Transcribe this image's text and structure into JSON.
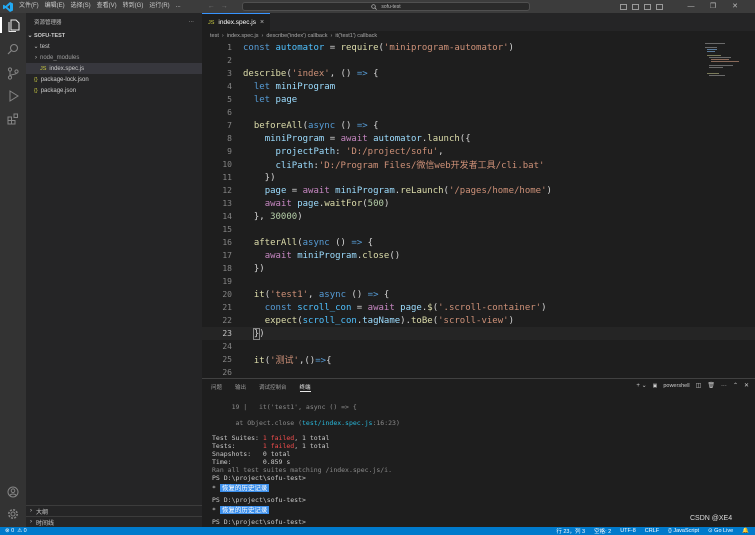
{
  "titlebar": {
    "menu": [
      "文件(F)",
      "编辑(E)",
      "选择(S)",
      "查看(V)",
      "转到(G)",
      "运行(R)",
      "..."
    ],
    "search_text": "sofu-test",
    "nav_back": "←",
    "nav_forward": "→"
  },
  "sidebar": {
    "header": "资源管理器",
    "more": "···",
    "project": "SOFU-TEST",
    "items": [
      {
        "label": "test",
        "type": "folder",
        "open": true
      },
      {
        "label": "node_modules",
        "type": "folder",
        "open": false
      },
      {
        "label": "index.spec.js",
        "type": "js"
      },
      {
        "label": "package-lock.json",
        "type": "json"
      },
      {
        "label": "package.json",
        "type": "json"
      }
    ],
    "outline": "大纲",
    "timeline": "时间线"
  },
  "editor": {
    "tab": {
      "label": "index.spec.js",
      "close": "×"
    },
    "breadcrumbs": [
      "test",
      "›",
      "index.spec.js",
      "›",
      "describe('index') callback",
      "›",
      "it('test1') callback"
    ],
    "cursor_line": 23
  },
  "panel": {
    "tabs": [
      "问题",
      "输出",
      "调试控制台",
      "终端"
    ],
    "active_tab": "终端",
    "terminal_name": "powershell",
    "lines": [
      {
        "t": "     19 |   it('test1', async () => {"
      },
      {
        "t": "      at Object.close (test/index.spec.js:16:23)"
      },
      {
        "t": "Test Suites: ",
        "r": "1 failed",
        "e": ", 1 total"
      },
      {
        "t": "Tests:       ",
        "r": "1 failed",
        "e": ", 1 total"
      },
      {
        "t": "Snapshots:   0 total"
      },
      {
        "t": "Time:        0.859 s"
      },
      {
        "t": "Ran all test suites matching /index.spec.js/i."
      },
      {
        "t": "PS D:\\project\\sofu-test>"
      },
      {
        "t": "恢复的历史记录"
      },
      {
        "t": "PS D:\\project\\sofu-test>"
      },
      {
        "t": "恢复的历史记录"
      },
      {
        "t": "PS D:\\project\\sofu-test>"
      }
    ]
  },
  "statusbar": {
    "errors": "⊗ 0",
    "warnings": "⚠ 0",
    "position": "行 23，列 3",
    "spaces": "空格: 2",
    "encoding": "UTF-8",
    "eol": "CRLF",
    "language": "{} JavaScript",
    "golive": "⊙ Go Live",
    "notif": "🔔"
  },
  "watermark": "CSDN @XE4"
}
